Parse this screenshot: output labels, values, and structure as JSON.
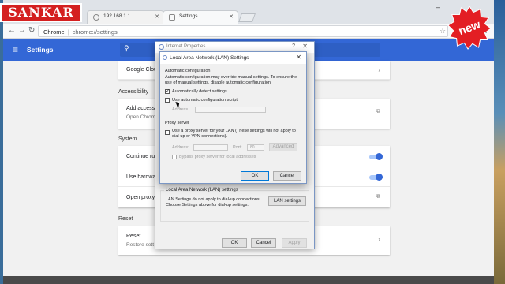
{
  "watermark": {
    "left_text": "SANKAR",
    "badge_text": "new",
    "badge_color": "#e31e24"
  },
  "browser": {
    "tabs": [
      {
        "label": "192.168.1.1",
        "active": false
      },
      {
        "label": "Settings",
        "active": true
      }
    ],
    "address": {
      "scheme_label": "Chrome",
      "path": "chrome://settings"
    }
  },
  "settings": {
    "header_title": "Settings",
    "accent": "#3367d6",
    "rows": {
      "google_cloud": "Google Clou",
      "accessibility_section": "Accessibility",
      "add_access_title": "Add access",
      "add_access_sub": "Open Chrom",
      "system_section": "System",
      "continue_title": "Continue ru",
      "hardware_title": "Use hardwa",
      "proxy_title": "Open proxy",
      "reset_section": "Reset",
      "reset_title": "Reset",
      "reset_sub": "Restore sett"
    }
  },
  "internet_properties": {
    "title": "Internet Properties",
    "lan_group_label": "Local Area Network (LAN) settings",
    "lan_group_text": "LAN Settings do not apply to dial-up connections. Choose Settings above for dial-up settings.",
    "lan_settings_button": "LAN settings",
    "ok": "OK",
    "cancel": "Cancel",
    "apply": "Apply"
  },
  "lan_dialog": {
    "title": "Local Area Network (LAN) Settings",
    "auto_config_label": "Automatic configuration",
    "auto_config_text": "Automatic configuration may override manual settings. To ensure the use of manual settings, disable automatic configuration.",
    "auto_detect_label": "Automatically detect settings",
    "auto_detect_checked": true,
    "use_script_label": "Use automatic configuration script",
    "use_script_checked": false,
    "address_label": "Address",
    "proxy_label": "Proxy server",
    "use_proxy_label": "Use a proxy server for your LAN (These settings will not apply to dial-up or VPN connections).",
    "use_proxy_checked": false,
    "proxy_address_label": "Address:",
    "port_label": "Port:",
    "port_value": "80",
    "advanced_button": "Advanced",
    "bypass_label": "Bypass proxy server for local addresses",
    "ok": "OK",
    "cancel": "Cancel"
  }
}
